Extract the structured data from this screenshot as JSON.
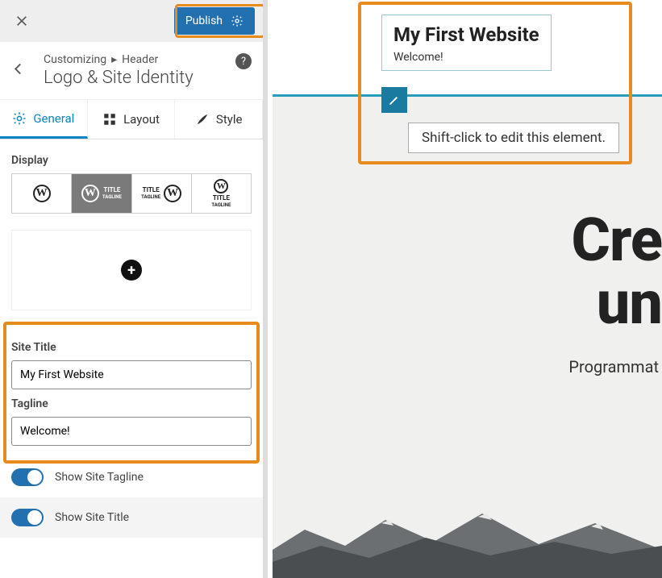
{
  "topbar": {
    "publish_label": "Publish"
  },
  "breadcrumb": {
    "customizing": "Customizing",
    "section": "Header",
    "title": "Logo & Site Identity"
  },
  "tabs": {
    "general": "General",
    "layout": "Layout",
    "style": "Style"
  },
  "display": {
    "label": "Display",
    "opt_title": "TITLE",
    "opt_tagline": "TAGLINE"
  },
  "form": {
    "site_title_label": "Site Title",
    "site_title_value": "My First Website",
    "tagline_label": "Tagline",
    "tagline_value": "Welcome!"
  },
  "toggles": {
    "show_tagline": "Show Site Tagline",
    "show_title": "Show Site Title"
  },
  "preview": {
    "site_title": "My First Website",
    "tagline": "Welcome!",
    "tooltip": "Shift-click to edit this element.",
    "hero_line1": "Cre",
    "hero_line2": "un",
    "hero_sub": "Programmat"
  }
}
